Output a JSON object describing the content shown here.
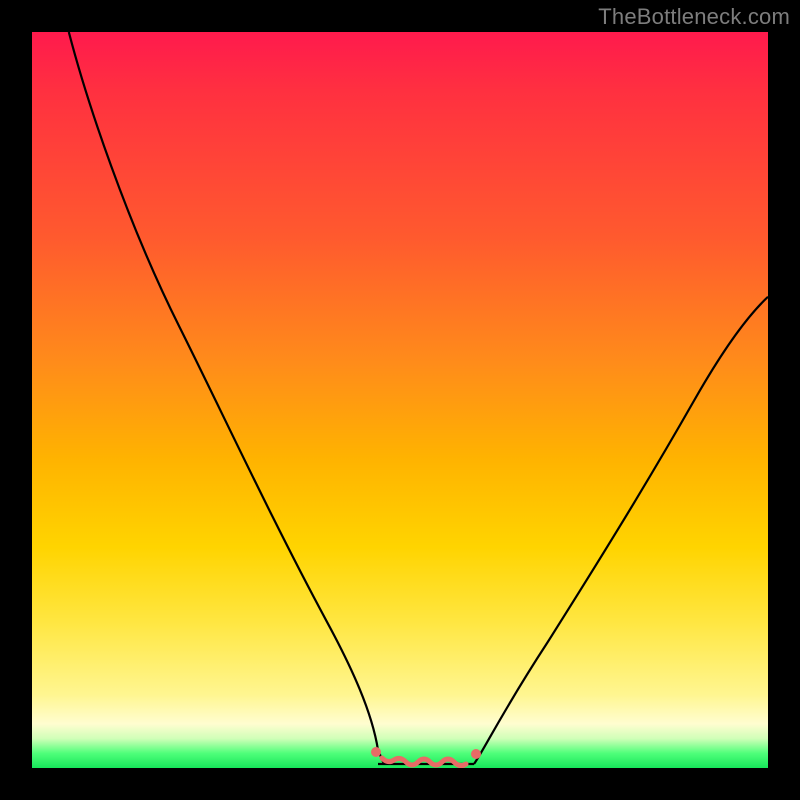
{
  "watermark": {
    "text": "TheBottleneck.com"
  },
  "colors": {
    "background": "#000000",
    "curve": "#000000",
    "accent": "#e86b66",
    "gradient_top": "#ff1a4d",
    "gradient_bottom": "#17e65a"
  },
  "chart_data": {
    "type": "line",
    "title": "",
    "xlabel": "",
    "ylabel": "",
    "xlim": [
      0,
      100
    ],
    "ylim": [
      0,
      100
    ],
    "grid": false,
    "legend": false,
    "series": [
      {
        "name": "bottleneck_curve",
        "x": [
          5,
          10,
          15,
          20,
          25,
          30,
          35,
          40,
          45,
          47,
          50,
          53,
          55,
          57,
          60,
          65,
          70,
          75,
          80,
          85,
          90,
          95,
          100
        ],
        "y": [
          100,
          88,
          76,
          64,
          52,
          40,
          29,
          18,
          7,
          2,
          0,
          0,
          0,
          0,
          2,
          9,
          17,
          25,
          33,
          42,
          50,
          58,
          64
        ]
      }
    ],
    "floor_segment": {
      "x_start": 47,
      "x_end": 60,
      "y": 0,
      "label": ""
    }
  }
}
